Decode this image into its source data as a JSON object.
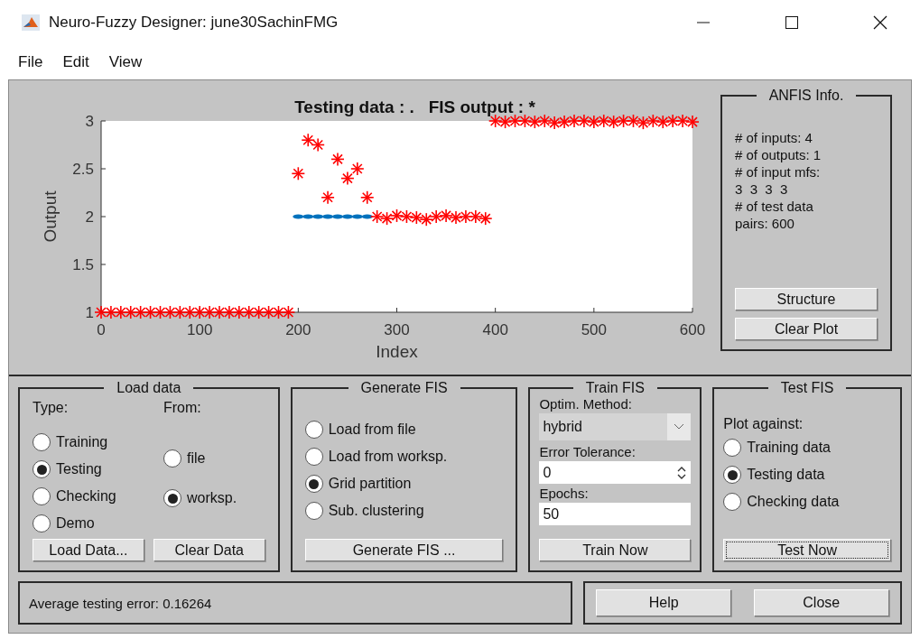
{
  "window": {
    "title": "Neuro-Fuzzy Designer: june30SachinFMG"
  },
  "menu": [
    "File",
    "Edit",
    "View"
  ],
  "plot": {
    "chart_data": {
      "type": "scatter",
      "title": "Testing data : .   FIS output : *",
      "xlabel": "Index",
      "ylabel": "Output",
      "xlim": [
        0,
        600
      ],
      "ylim": [
        1,
        3
      ],
      "xticks": [
        0,
        100,
        200,
        300,
        400,
        500,
        600
      ],
      "yticks": [
        1,
        1.5,
        2,
        2.5,
        3
      ],
      "x": [
        0,
        10,
        20,
        30,
        40,
        50,
        60,
        70,
        80,
        90,
        100,
        110,
        120,
        130,
        140,
        150,
        160,
        170,
        180,
        190,
        200,
        210,
        220,
        230,
        240,
        250,
        260,
        270,
        280,
        290,
        300,
        310,
        320,
        330,
        340,
        350,
        360,
        370,
        380,
        390,
        400,
        410,
        420,
        430,
        440,
        450,
        460,
        470,
        480,
        490,
        500,
        510,
        520,
        530,
        540,
        550,
        560,
        570,
        580,
        590,
        600
      ],
      "series": [
        {
          "color": "#0072bd",
          "values": [
            null,
            null,
            null,
            null,
            null,
            null,
            null,
            null,
            null,
            null,
            null,
            null,
            null,
            null,
            null,
            null,
            null,
            null,
            null,
            null,
            2,
            2,
            2,
            2,
            2,
            2,
            2,
            2,
            null,
            null,
            null,
            null,
            null,
            null,
            null,
            null,
            null,
            null,
            null,
            null,
            null,
            null,
            null,
            null,
            null,
            null,
            null,
            null,
            null,
            null,
            null,
            null,
            null,
            null,
            null,
            null,
            null,
            null,
            null,
            null,
            null
          ]
        },
        {
          "color": "#ff0000",
          "values": [
            1,
            1,
            1,
            1,
            1,
            1,
            1,
            1,
            1,
            1,
            1,
            1,
            1,
            1,
            1,
            1,
            1,
            1,
            1,
            1,
            2.45,
            2.8,
            2.75,
            2.2,
            2.6,
            2.4,
            2.5,
            2.2,
            2.0,
            1.98,
            2.01,
            2.0,
            1.99,
            1.97,
            2.0,
            2.01,
            1.99,
            2.0,
            2.0,
            1.98,
            3.0,
            2.99,
            3.0,
            3.0,
            2.99,
            3.0,
            2.98,
            2.99,
            3.0,
            3.0,
            2.99,
            3.0,
            2.99,
            3.0,
            3.0,
            2.98,
            3.0,
            2.99,
            3.0,
            3.0,
            2.99
          ]
        }
      ]
    }
  },
  "anfis_info": {
    "title": "ANFIS Info.",
    "lines": [
      "# of inputs: 4",
      "# of outputs: 1",
      "# of input mfs:",
      "3  3  3  3",
      "# of test data",
      "pairs: 600"
    ],
    "buttons": [
      "Structure",
      "Clear Plot"
    ]
  },
  "load_data": {
    "title": "Load data",
    "type_label": "Type:",
    "from_label": "From:",
    "types": [
      {
        "label": "Training",
        "selected": false
      },
      {
        "label": "Testing",
        "selected": true
      },
      {
        "label": "Checking",
        "selected": false
      },
      {
        "label": "Demo",
        "selected": false
      }
    ],
    "sources": [
      {
        "label": "file",
        "selected": false
      },
      {
        "label": "worksp.",
        "selected": true
      }
    ],
    "buttons": [
      "Load Data...",
      "Clear Data"
    ]
  },
  "generate_fis": {
    "title": "Generate FIS",
    "options": [
      {
        "label": "Load from file",
        "selected": false
      },
      {
        "label": "Load from worksp.",
        "selected": false
      },
      {
        "label": "Grid partition",
        "selected": true
      },
      {
        "label": "Sub. clustering",
        "selected": false
      }
    ],
    "button": "Generate FIS ..."
  },
  "train_fis": {
    "title": "Train FIS",
    "method_label": "Optim. Method:",
    "method": "hybrid",
    "tolerance_label": "Error Tolerance:",
    "tolerance": "0",
    "epochs_label": "Epochs:",
    "epochs": "50",
    "button": "Train Now"
  },
  "test_fis": {
    "title": "Test FIS",
    "plot_label": "Plot against:",
    "options": [
      {
        "label": "Training data",
        "selected": false
      },
      {
        "label": "Testing data",
        "selected": true
      },
      {
        "label": "Checking data",
        "selected": false
      }
    ],
    "button": {
      "label": "Test Now",
      "focused": true
    }
  },
  "status": "Average testing error: 0.16264",
  "buttons": [
    "Help",
    "Close"
  ]
}
